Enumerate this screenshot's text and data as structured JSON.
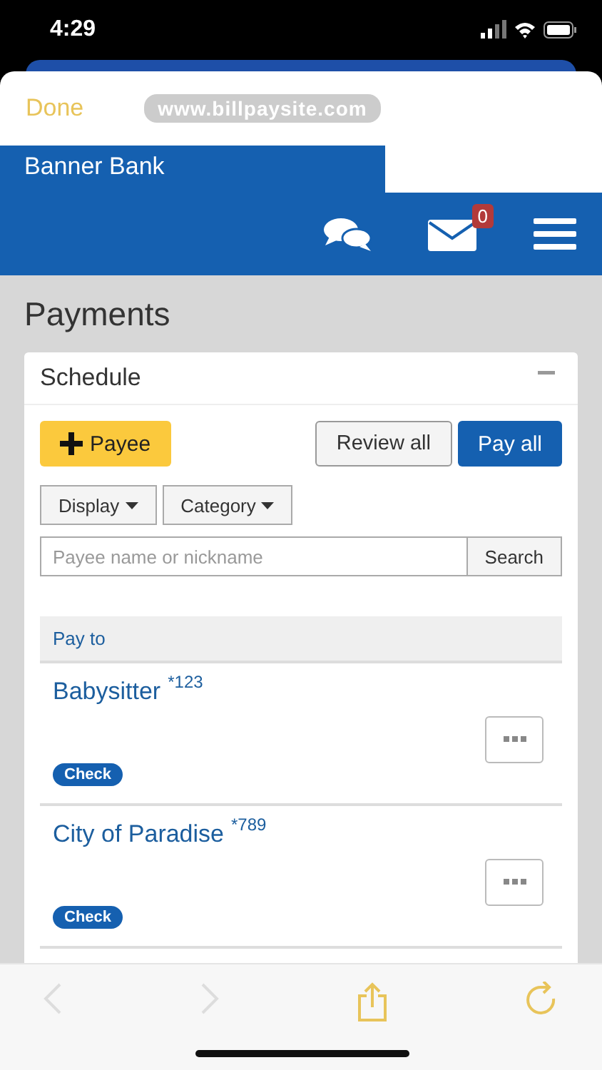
{
  "status_bar": {
    "time": "4:29"
  },
  "browser": {
    "done": "Done",
    "url": "www.billpaysite.com"
  },
  "header": {
    "bank_name": "Banner Bank",
    "mail_count": "0"
  },
  "page_title": "Payments",
  "schedule": {
    "title": "Schedule",
    "expanded": true,
    "add_button": "Payee",
    "review_button": "Review all",
    "pay_button": "Pay all",
    "filters": [
      "Display",
      "Category"
    ],
    "search": {
      "placeholder": "Payee name or nickname",
      "button": "Search"
    },
    "column_header": "Pay to",
    "payees": [
      {
        "name": "Babysitter",
        "account": "*123",
        "method": "Check"
      },
      {
        "name": "City of Paradise",
        "account": "*789",
        "method": "Check"
      }
    ]
  },
  "toolbar": [
    {
      "kind": "back",
      "disabled": true
    },
    {
      "kind": "forward",
      "disabled": true
    },
    {
      "kind": "share",
      "disabled": false
    },
    {
      "kind": "reload",
      "disabled": false
    }
  ]
}
